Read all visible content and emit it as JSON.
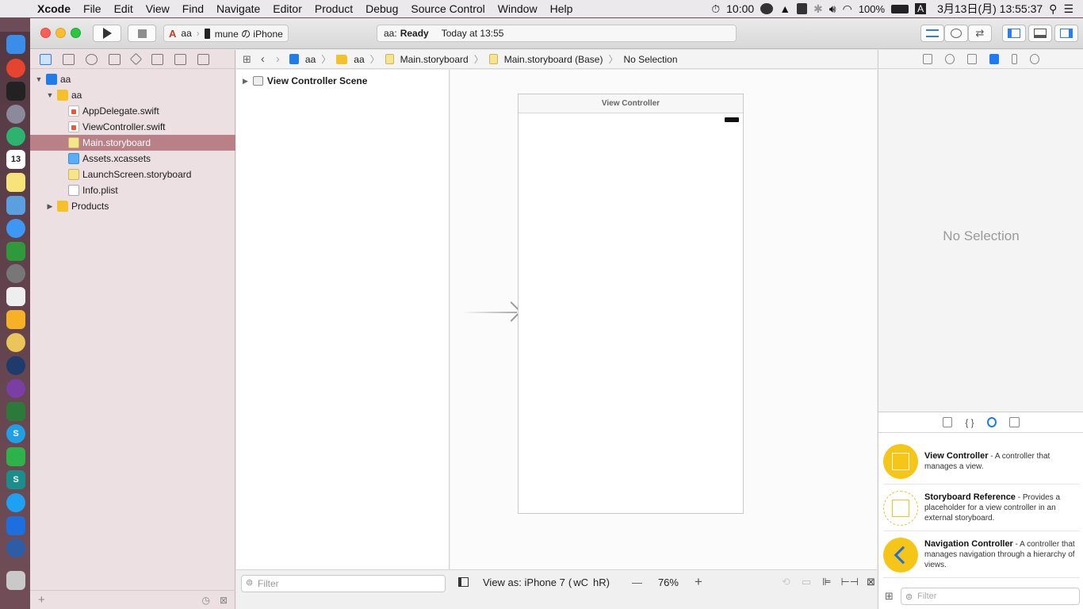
{
  "menubar": {
    "app_name": "Xcode",
    "items": [
      "File",
      "Edit",
      "View",
      "Find",
      "Navigate",
      "Editor",
      "Product",
      "Debug",
      "Source Control",
      "Window",
      "Help"
    ],
    "clock_timer": "10:00",
    "battery": "100%",
    "input_method": "A",
    "datetime": "3月13日(月)  13:55:37"
  },
  "toolbar": {
    "scheme_target": "aa",
    "scheme_device": "mune の iPhone",
    "status_project": "aa:",
    "status_state": "Ready",
    "status_time": "Today at 13:55"
  },
  "navigator": {
    "tree": [
      {
        "label": "aa",
        "type": "proj"
      },
      {
        "label": "aa",
        "type": "folder"
      },
      {
        "label": "AppDelegate.swift",
        "type": "swift"
      },
      {
        "label": "ViewController.swift",
        "type": "swift"
      },
      {
        "label": "Main.storyboard",
        "type": "sb",
        "selected": true
      },
      {
        "label": "Assets.xcassets",
        "type": "assets"
      },
      {
        "label": "LaunchScreen.storyboard",
        "type": "sb"
      },
      {
        "label": "Info.plist",
        "type": "plist"
      },
      {
        "label": "Products",
        "type": "folder"
      }
    ]
  },
  "jumpbar": {
    "crumbs": [
      "aa",
      "aa",
      "Main.storyboard",
      "Main.storyboard (Base)",
      "No Selection"
    ]
  },
  "outline": {
    "scene_label": "View Controller Scene",
    "filter_placeholder": "Filter"
  },
  "canvas": {
    "scene_title": "View Controller",
    "view_as": "View as: iPhone 7",
    "size_class_w": "wC",
    "size_class_h": "hR",
    "size_class_close": ")",
    "zoom_minus": "—",
    "zoom": "76%",
    "zoom_plus": "+"
  },
  "inspector": {
    "no_selection": "No Selection"
  },
  "library": {
    "items": [
      {
        "title": "View Controller",
        "desc": " - A controller that manages a view."
      },
      {
        "title": "Storyboard Reference",
        "desc": " - Provides a placeholder for a view controller in an external storyboard."
      },
      {
        "title": "Navigation Controller",
        "desc": " - A controller that manages navigation through a hierarchy of views."
      }
    ],
    "filter_placeholder": "Filter"
  },
  "colors": {
    "accent": "#1f7bf2",
    "selection": "#b98087",
    "library_yellow": "#f5c518"
  }
}
